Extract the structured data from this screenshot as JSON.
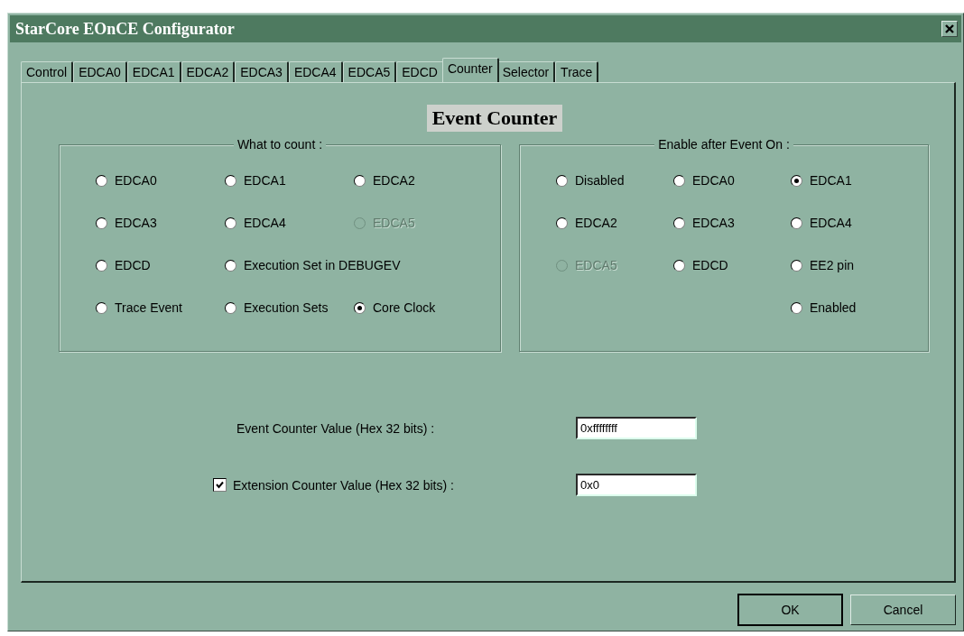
{
  "window": {
    "title": "StarCore EOnCE Configurator"
  },
  "tabs": [
    {
      "label": "Control",
      "selected": false
    },
    {
      "label": "EDCA0",
      "selected": false
    },
    {
      "label": "EDCA1",
      "selected": false
    },
    {
      "label": "EDCA2",
      "selected": false
    },
    {
      "label": "EDCA3",
      "selected": false
    },
    {
      "label": "EDCA4",
      "selected": false
    },
    {
      "label": "EDCA5",
      "selected": false
    },
    {
      "label": "EDCD",
      "selected": false
    },
    {
      "label": "Counter",
      "selected": true
    },
    {
      "label": "Selector",
      "selected": false
    },
    {
      "label": "Trace",
      "selected": false
    }
  ],
  "heading": "Event Counter",
  "groups": [
    {
      "title": "What to count :",
      "options": [
        {
          "label": "EDCA0",
          "selected": false,
          "disabled": false
        },
        {
          "label": "EDCA1",
          "selected": false,
          "disabled": false
        },
        {
          "label": "EDCA2",
          "selected": false,
          "disabled": false
        },
        {
          "label": "EDCA3",
          "selected": false,
          "disabled": false
        },
        {
          "label": "EDCA4",
          "selected": false,
          "disabled": false
        },
        {
          "label": "EDCA5",
          "selected": false,
          "disabled": true
        },
        {
          "label": "EDCD",
          "selected": false,
          "disabled": false
        },
        {
          "label": "Execution Set in DEBUGEV",
          "selected": false,
          "disabled": false
        },
        {
          "label": "Trace Event",
          "selected": false,
          "disabled": false
        },
        {
          "label": "Execution Sets",
          "selected": false,
          "disabled": false
        },
        {
          "label": "Core Clock",
          "selected": true,
          "disabled": false
        }
      ]
    },
    {
      "title": "Enable after Event On :",
      "options": [
        {
          "label": "Disabled",
          "selected": false,
          "disabled": false
        },
        {
          "label": "EDCA0",
          "selected": false,
          "disabled": false
        },
        {
          "label": "EDCA1",
          "selected": true,
          "disabled": false
        },
        {
          "label": "EDCA2",
          "selected": false,
          "disabled": false
        },
        {
          "label": "EDCA3",
          "selected": false,
          "disabled": false
        },
        {
          "label": "EDCA4",
          "selected": false,
          "disabled": false
        },
        {
          "label": "EDCA5",
          "selected": false,
          "disabled": true
        },
        {
          "label": "EDCD",
          "selected": false,
          "disabled": false
        },
        {
          "label": "EE2 pin",
          "selected": false,
          "disabled": false
        },
        {
          "label": "Enabled",
          "selected": false,
          "disabled": false
        }
      ]
    }
  ],
  "fields": [
    {
      "kind": "plain",
      "label": "Event Counter Value (Hex 32 bits) :",
      "value": "0xffffffff"
    },
    {
      "kind": "checkbox",
      "checked": true,
      "label": "Extension Counter Value (Hex 32 bits) :",
      "value": "0x0"
    }
  ],
  "buttons": [
    {
      "label": "OK",
      "default": true
    },
    {
      "label": "Cancel",
      "default": false
    }
  ]
}
